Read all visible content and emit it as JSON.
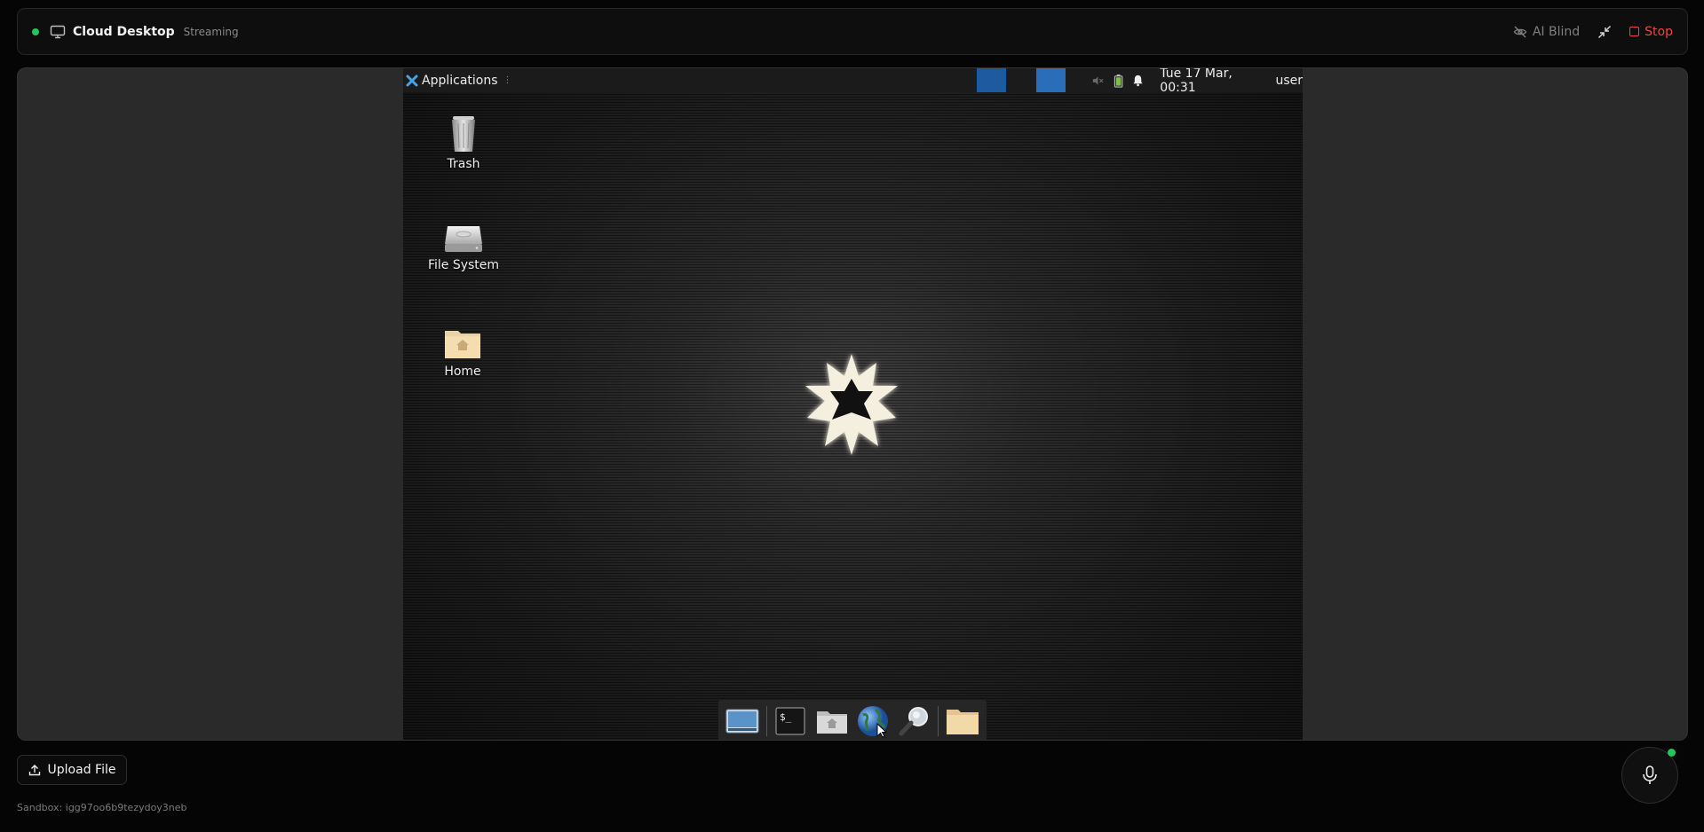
{
  "header": {
    "title": "Cloud Desktop",
    "status": "Streaming",
    "ai_blind_label": "AI Blind",
    "stop_label": "Stop",
    "status_color": "#22c55e",
    "stop_color": "#ef4444"
  },
  "desktop": {
    "panel": {
      "applications_label": "Applications",
      "clock": "Tue 17 Mar, 00:31",
      "user": "user",
      "workspace_color": "#1e5aa0"
    },
    "icons": [
      {
        "label": "Trash",
        "icon": "trash-icon"
      },
      {
        "label": "File System",
        "icon": "drive-icon"
      },
      {
        "label": "Home",
        "icon": "home-folder-icon"
      }
    ],
    "dock": [
      {
        "icon": "show-desktop-icon"
      },
      {
        "icon": "terminal-icon"
      },
      {
        "icon": "home-folder-icon"
      },
      {
        "icon": "web-browser-icon"
      },
      {
        "icon": "search-icon"
      },
      {
        "icon": "folder-icon"
      }
    ]
  },
  "footer": {
    "upload_label": "Upload File",
    "sandbox_text": "Sandbox: igg97oo6b9tezydoy3neb"
  }
}
